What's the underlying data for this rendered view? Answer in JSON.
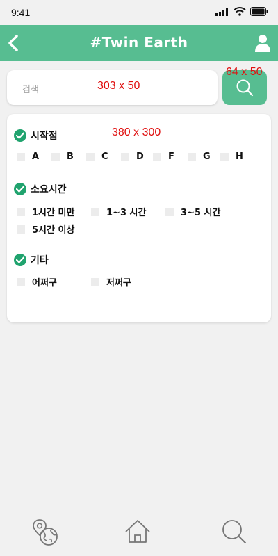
{
  "status_bar": {
    "time": "9:41"
  },
  "header": {
    "title": "#Twin Earth"
  },
  "search": {
    "placeholder": "검색",
    "size_label": "303 x 50",
    "button_size_label": "64 x 50"
  },
  "filter_panel": {
    "size_label": "380 x 300",
    "sections": [
      {
        "title": "시작점",
        "options": [
          "A",
          "B",
          "C",
          "D",
          "F",
          "G",
          "H"
        ]
      },
      {
        "title": "소요시간",
        "options": [
          "1시간 미만",
          "1~3 시간",
          "3~5 시간",
          "5시간 이상"
        ]
      },
      {
        "title": "기타",
        "options": [
          "어쩌구",
          "저쩌구"
        ]
      }
    ]
  },
  "colors": {
    "accent": "#57bd91",
    "check": "#20a36e",
    "annotation": "#e01010"
  },
  "icons": [
    "back-arrow-icon",
    "user-icon",
    "search-icon",
    "map-globe-icon",
    "home-icon"
  ]
}
